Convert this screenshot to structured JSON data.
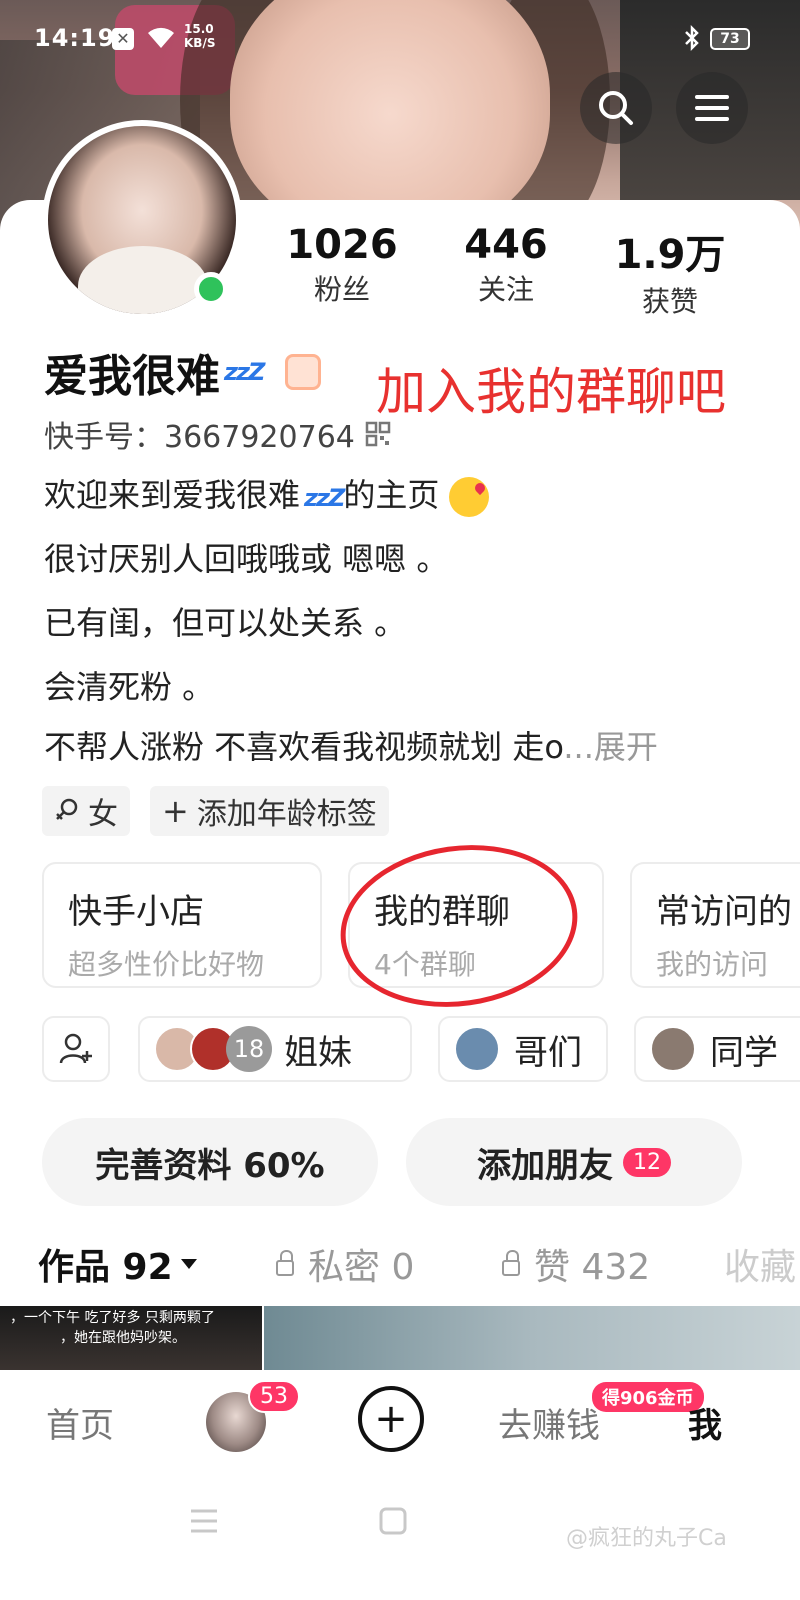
{
  "status_bar": {
    "time": "14:19",
    "net_speed_value": "15.0",
    "net_speed_unit": "KB/S",
    "battery": "73"
  },
  "header": {
    "search_icon": "search-icon",
    "menu_icon": "menu-icon"
  },
  "profile": {
    "stats": [
      {
        "value": "1026",
        "label": "粉丝"
      },
      {
        "value": "446",
        "label": "关注"
      },
      {
        "value": "1.9万",
        "label": "获赞"
      }
    ],
    "name": "爱我很难",
    "name_emoji": "zzZ",
    "kwai_id": "快手号：3667920764",
    "overlay_caption": "加入我的群聊吧",
    "bio": [
      "欢迎来到爱我很难",
      "的主页",
      "很讨厌别人回哦哦或 嗯嗯 。",
      "已有闺，但可以处关系 。",
      "会清死粉 。",
      "不帮人涨粉 不喜欢看我视频就划 走o",
      "...展开"
    ],
    "tags": [
      "女",
      "添加年龄标签"
    ]
  },
  "cards": [
    {
      "title": "快手小店",
      "subtitle": "超多性价比好物"
    },
    {
      "title": "我的群聊",
      "subtitle": "4个群聊"
    },
    {
      "title": "常访问的",
      "subtitle": "我的访问"
    }
  ],
  "groups": {
    "sisters_count": "18",
    "items": [
      "姐妹",
      "哥们",
      "同学"
    ]
  },
  "actions": {
    "complete_profile": "完善资料 60%",
    "add_friends": "添加朋友",
    "add_friends_count": "12"
  },
  "tabs": [
    {
      "label": "作品 92"
    },
    {
      "label": "私密 0"
    },
    {
      "label": "赞 432"
    },
    {
      "label": "收藏"
    }
  ],
  "thumbs": {
    "caption_line1": "，一个下午 吃了好多 只剩两颗了",
    "caption_line2": "，她在跟他妈吵架。"
  },
  "bottom_nav": {
    "home": "首页",
    "message_badge": "53",
    "plus": "+",
    "earn": "去赚钱",
    "coin_badge": "得906金币",
    "me": "我"
  },
  "watermark": "@疯狂的丸子Ca",
  "colors": {
    "accent": "#fe3666",
    "online": "#2fc25b",
    "annotation_red": "#e6262f"
  }
}
